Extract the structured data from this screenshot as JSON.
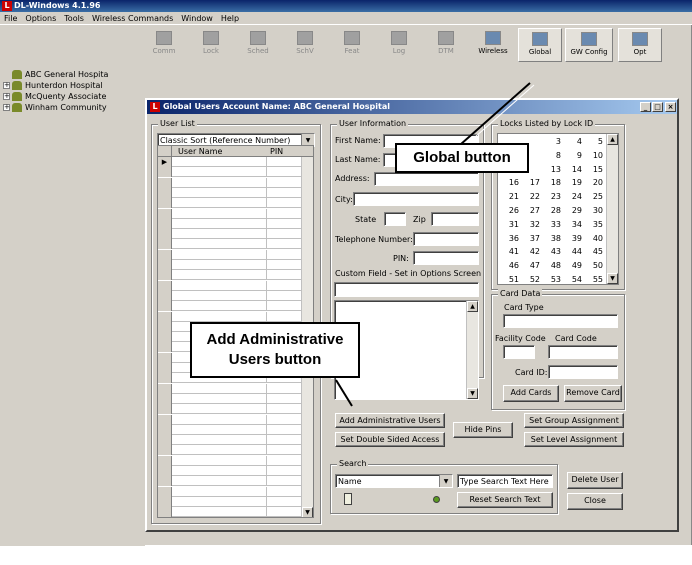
{
  "app": {
    "title": "DL-Windows 4.1.96",
    "icon_glyph": "L"
  },
  "menu": [
    "File",
    "Options",
    "Tools",
    "Wireless Commands",
    "Window",
    "Help"
  ],
  "toolbar": [
    {
      "label": "Comm",
      "icon": "comm-icon",
      "enabled": false
    },
    {
      "label": "Lock",
      "icon": "lock-icon",
      "enabled": false
    },
    {
      "label": "Sched",
      "icon": "schedule-icon",
      "enabled": false
    },
    {
      "label": "SchV",
      "icon": "schedule-view-icon",
      "enabled": false
    },
    {
      "label": "Feat",
      "icon": "features-icon",
      "enabled": false
    },
    {
      "label": "Log",
      "icon": "log-icon",
      "enabled": false
    },
    {
      "label": "DTM",
      "icon": "dtm-icon",
      "enabled": false
    },
    {
      "label": "Wireless",
      "icon": "wireless-icon",
      "enabled": true
    },
    {
      "label": "Global",
      "icon": "globe-icon",
      "enabled": true
    },
    {
      "label": "GW Config",
      "icon": "gateway-config-icon",
      "enabled": true
    },
    {
      "label": "Opt",
      "icon": "options-icon",
      "enabled": true
    }
  ],
  "tree": [
    {
      "label": "ABC General Hospita",
      "expandable": false
    },
    {
      "label": "Hunterdon Hospital",
      "expandable": true
    },
    {
      "label": "McQuenty Associate",
      "expandable": true
    },
    {
      "label": "Winham Community",
      "expandable": true
    }
  ],
  "window": {
    "title": "Global Users Account Name: ABC General Hospital",
    "user_list": {
      "label": "User List",
      "sort": "Classic Sort (Reference Number)",
      "columns": [
        "User Name",
        "PIN"
      ],
      "row_count": 35
    },
    "user_info": {
      "label": "User Information",
      "first_name": "First Name:",
      "last_name": "Last Name:",
      "address": "Address:",
      "city": "City:",
      "state": "State",
      "zip": "Zip",
      "phone": "Telephone Number:",
      "pin": "PIN:",
      "custom": "Custom Field - Set in Options Screen"
    },
    "locks": {
      "label": "Locks Listed by Lock ID",
      "visible": [
        "3",
        "4",
        "5",
        "8",
        "9",
        "10",
        "13",
        "14",
        "15",
        "16",
        "17",
        "18",
        "19",
        "20",
        "21",
        "22",
        "23",
        "24",
        "25",
        "26",
        "27",
        "28",
        "29",
        "30",
        "31",
        "32",
        "33",
        "34",
        "35",
        "36",
        "37",
        "38",
        "39",
        "40",
        "41",
        "42",
        "43",
        "44",
        "45",
        "46",
        "47",
        "48",
        "49",
        "50",
        "51",
        "52",
        "53",
        "54",
        "55"
      ]
    },
    "card": {
      "label": "Card Data",
      "card_type": "Card Type",
      "facility_code": "Facility Code",
      "card_code": "Card Code",
      "card_id": "Card ID:",
      "add_cards": "Add Cards",
      "remove_card": "Remove Card"
    },
    "buttons": {
      "add_admin": "Add Administrative Users",
      "double_sided": "Set Double Sided Access",
      "hide_pins": "Hide Pins",
      "group": "Set Group Assignment",
      "level": "Set Level Assignment"
    },
    "search": {
      "label": "Search",
      "field": "Name",
      "placeholder": "Type Search Text Here",
      "reset": "Reset Search Text"
    },
    "delete_user": "Delete User",
    "close": "Close"
  },
  "callouts": {
    "global": "Global button",
    "admin_line1": "Add Administrative",
    "admin_line2": "Users button"
  }
}
